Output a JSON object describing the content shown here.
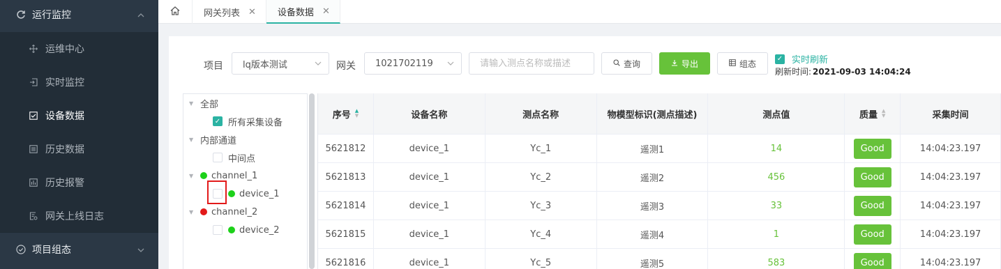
{
  "sidebar": {
    "group_title": "运行监控",
    "items": [
      {
        "label": "运维中心",
        "icon": "move-icon"
      },
      {
        "label": "实时监控",
        "icon": "login-icon"
      },
      {
        "label": "设备数据",
        "icon": "checkbox-icon",
        "active": true
      },
      {
        "label": "历史数据",
        "icon": "document-list-icon"
      },
      {
        "label": "历史报警",
        "icon": "chart-icon"
      },
      {
        "label": "网关上线日志",
        "icon": "log-icon"
      }
    ],
    "bottom_group_title": "项目组态"
  },
  "tabs": [
    {
      "label": "网关列表",
      "active": false
    },
    {
      "label": "设备数据",
      "active": true
    }
  ],
  "filter": {
    "project_label": "项目",
    "project_value": "lq版本测试",
    "gateway_label": "网关",
    "gateway_value": "1021702119",
    "search_placeholder": "请输入测点名称或描述",
    "query_label": "查询",
    "export_label": "导出",
    "config_label": "组态",
    "realtime_label": "实时刷新",
    "realtime_checked": true,
    "refresh_label": "刷新时间:",
    "refresh_time": "2021-09-03 14:04:24"
  },
  "tree": {
    "root": "全部",
    "all_devices": "所有采集设备",
    "internal": "内部通道",
    "middle_point": "中间点",
    "channel1": "channel_1",
    "device1": "device_1",
    "channel2": "channel_2",
    "device2": "device_2"
  },
  "table": {
    "headers": [
      "序号",
      "设备名称",
      "测点名称",
      "物模型标识(测点描述)",
      "测点值",
      "质量",
      "采集时间"
    ],
    "rows": [
      {
        "id": "5621812",
        "device": "device_1",
        "point": "Yc_1",
        "desc": "遥测1",
        "value": "14",
        "quality": "Good",
        "time": "14:04:23.197"
      },
      {
        "id": "5621813",
        "device": "device_1",
        "point": "Yc_2",
        "desc": "遥测2",
        "value": "456",
        "quality": "Good",
        "time": "14:04:23.197"
      },
      {
        "id": "5621814",
        "device": "device_1",
        "point": "Yc_3",
        "desc": "遥测3",
        "value": "33",
        "quality": "Good",
        "time": "14:04:23.197"
      },
      {
        "id": "5621815",
        "device": "device_1",
        "point": "Yc_4",
        "desc": "遥测4",
        "value": "1",
        "quality": "Good",
        "time": "14:04:23.197"
      },
      {
        "id": "5621816",
        "device": "device_1",
        "point": "Yc_5",
        "desc": "遥测5",
        "value": "583",
        "quality": "Good",
        "time": "14:04:23.197"
      }
    ]
  },
  "colors": {
    "accent": "#2bb3a3",
    "success": "#67c23a",
    "sidebar_bg": "#2b3845",
    "online": "#1dd11a",
    "offline": "#e21a1a"
  }
}
